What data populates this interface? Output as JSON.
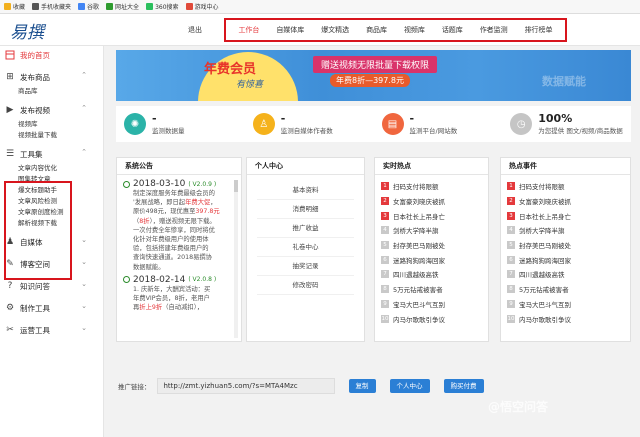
{
  "bookmarks": [
    {
      "label": "收藏",
      "color": "#f2b01e"
    },
    {
      "label": "手机收藏夹",
      "color": "#555555"
    },
    {
      "label": "谷歌",
      "color": "#4285f4"
    },
    {
      "label": "网址大全",
      "color": "#2e9b2e"
    },
    {
      "label": "360搜索",
      "color": "#2bbf5d"
    },
    {
      "label": "游戏中心",
      "color": "#e04a3a"
    }
  ],
  "header": {
    "logo": "易撰",
    "exit": "退出",
    "nav": [
      "工作台",
      "自媒体库",
      "爆文精选",
      "商品库",
      "视频库",
      "话题库",
      "作者监测",
      "排行榜单"
    ],
    "active_nav": 0
  },
  "sidebar": {
    "home": "我的首页",
    "sections": [
      {
        "label": "发布商品",
        "icon": "plus-square-icon",
        "subs": [
          "商品库"
        ]
      },
      {
        "label": "发布视频",
        "icon": "play-circle-icon",
        "subs": [
          "视频库",
          "视频批量下载"
        ]
      },
      {
        "label": "工具集",
        "icon": "toolbox-icon",
        "subs": [
          "文章内容优化",
          "图集转文章",
          "爆文标题助手",
          "文章风险检测",
          "文章原创度检测",
          "解析视频下载"
        ]
      },
      {
        "label": "自媒体",
        "icon": "media-icon",
        "subs": []
      },
      {
        "label": "博客空间",
        "icon": "blog-icon",
        "subs": []
      },
      {
        "label": "知识问答",
        "icon": "question-icon",
        "subs": []
      },
      {
        "label": "制作工具",
        "icon": "tools-icon",
        "subs": []
      },
      {
        "label": "运营工具",
        "icon": "wrench-icon",
        "subs": []
      }
    ]
  },
  "banner": {
    "title": "年费会员",
    "subtitle": "有惊喜",
    "slogan": "赠送视频无限批量下载权限",
    "price": "年费8折—397.8元",
    "right": "数据赋能"
  },
  "stats": [
    {
      "value": "-",
      "label": "监测数据量",
      "color": "#2bb3a8",
      "icon": "satellite-icon"
    },
    {
      "value": "-",
      "label": "监测自媒体作者数",
      "color": "#f5b21b",
      "icon": "person-icon"
    },
    {
      "value": "-",
      "label": "监测平台/网站数",
      "color": "#f0663e",
      "icon": "book-icon"
    },
    {
      "value": "100%",
      "label": "为您提供 图文/视频/商品数据",
      "color": "#c5c5c5",
      "icon": "clock-icon"
    }
  ],
  "announcements": {
    "title": "系统公告",
    "items": [
      {
        "date": "2018-03-10",
        "version": "( V2.0.9 )",
        "lines": [
          [
            {
              "t": "制定深度服务年费最级会员的"
            }
          ],
          [
            {
              "t": "'发展战略，即日起"
            },
            {
              "t": "年费大促",
              "red": true
            },
            {
              "t": "，"
            }
          ],
          [
            {
              "t": "原价498元，现优惠至"
            },
            {
              "t": "397.8元",
              "red": true
            }
          ],
          [
            {
              "t": "（"
            },
            {
              "t": "8折",
              "red": true
            },
            {
              "t": "），赠送视频无限下载。"
            }
          ],
          [
            {
              "t": "一次付费全年惨享，同时将优"
            }
          ],
          [
            {
              "t": "化针对年费级用户的使用体"
            }
          ],
          [
            {
              "t": "验，包括搭建年费级用户的"
            }
          ],
          [
            {
              "t": "查询快速通道。2018易撰协"
            }
          ],
          [
            {
              "t": "数据赋能。"
            }
          ]
        ]
      },
      {
        "date": "2018-02-14",
        "version": "( V2.0.8 )",
        "lines": [
          [
            {
              "t": "1. 庆新年，大酬宾活动：买"
            }
          ],
          [
            {
              "t": "年费VIP会员，8折，老用户"
            }
          ],
          [
            {
              "t": "再"
            },
            {
              "t": "折上9折",
              "red": true
            },
            {
              "t": "（自动减扣），"
            }
          ]
        ]
      }
    ]
  },
  "personal": {
    "title": "个人中心",
    "items": [
      "基本资料",
      "消费明细",
      "推广收益",
      "礼卷中心",
      "抽奖记录",
      "修改密码"
    ]
  },
  "hotspot": {
    "title": "实时热点",
    "items": [
      "扫码支付将限额",
      "女富豪刘晓庆被抓",
      "日本社长上吊身亡",
      "剑桥大学降半旗",
      "封存美巴马刚被处",
      "迷路狗狗跨海回家",
      "四川遇越级高铁",
      "5万元钻戒被害者",
      "宝马大巴斗气互别",
      "内马尔歌歌引争议"
    ]
  },
  "hotevents": {
    "title": "热点事件",
    "items": [
      "扫码支付将限额",
      "女富豪刘晓庆被抓",
      "日本社长上吊身亡",
      "剑桥大学降半旗",
      "封存美巴马刚被处",
      "迷路狗狗跨海回家",
      "四川遇越级高铁",
      "5万元钻戒被害者",
      "宝马大巴斗气互别",
      "内马尔歌歌引争议"
    ]
  },
  "promo": {
    "label": "推广链接：",
    "url": "http://zmt.yizhuan5.com/?s=MTA4Mzc",
    "copy": "复制",
    "center": "个人中心",
    "buy": "购买付费"
  },
  "watermark": "@悟空问答"
}
